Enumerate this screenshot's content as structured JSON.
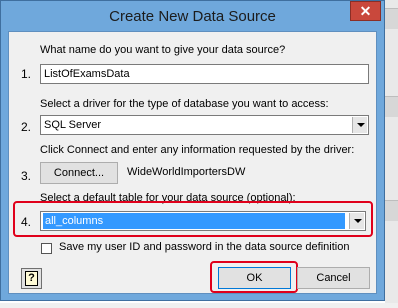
{
  "dialog": {
    "title": "Create New Data Source",
    "close_glyph": "✕"
  },
  "step1": {
    "number": "1.",
    "prompt": "What name do you want to give your data source?",
    "value": "ListOfExamsData"
  },
  "step2": {
    "number": "2.",
    "prompt": "Select a driver for the type of database you want to access:",
    "value": "SQL Server"
  },
  "step3": {
    "number": "3.",
    "prompt": "Click Connect and enter any information requested by the driver:",
    "connect_label": "Connect...",
    "connected_name": "WideWorldImportersDW"
  },
  "step4": {
    "number": "4.",
    "prompt": "Select a default table for your data source (optional):",
    "value": "all_columns"
  },
  "save_credentials": {
    "label": "Save my user ID and password in the data source definition",
    "checked": false
  },
  "buttons": {
    "help_glyph": "?",
    "ok_label": "OK",
    "cancel_label": "Cancel"
  },
  "colors": {
    "highlight": "#e0001b",
    "selection": "#3399ff",
    "window_frame": "#6fa8dc"
  }
}
